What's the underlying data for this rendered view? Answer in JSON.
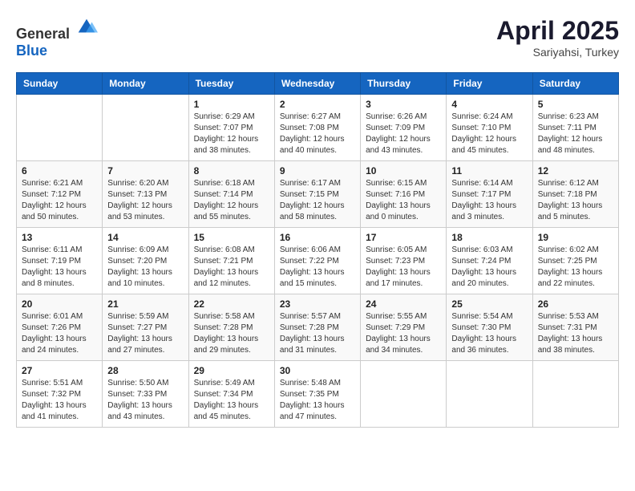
{
  "header": {
    "logo_general": "General",
    "logo_blue": "Blue",
    "month": "April 2025",
    "location": "Sariyahsi, Turkey"
  },
  "days_of_week": [
    "Sunday",
    "Monday",
    "Tuesday",
    "Wednesday",
    "Thursday",
    "Friday",
    "Saturday"
  ],
  "weeks": [
    [
      {
        "day": "",
        "sunrise": "",
        "sunset": "",
        "daylight": ""
      },
      {
        "day": "",
        "sunrise": "",
        "sunset": "",
        "daylight": ""
      },
      {
        "day": "1",
        "sunrise": "Sunrise: 6:29 AM",
        "sunset": "Sunset: 7:07 PM",
        "daylight": "Daylight: 12 hours and 38 minutes."
      },
      {
        "day": "2",
        "sunrise": "Sunrise: 6:27 AM",
        "sunset": "Sunset: 7:08 PM",
        "daylight": "Daylight: 12 hours and 40 minutes."
      },
      {
        "day": "3",
        "sunrise": "Sunrise: 6:26 AM",
        "sunset": "Sunset: 7:09 PM",
        "daylight": "Daylight: 12 hours and 43 minutes."
      },
      {
        "day": "4",
        "sunrise": "Sunrise: 6:24 AM",
        "sunset": "Sunset: 7:10 PM",
        "daylight": "Daylight: 12 hours and 45 minutes."
      },
      {
        "day": "5",
        "sunrise": "Sunrise: 6:23 AM",
        "sunset": "Sunset: 7:11 PM",
        "daylight": "Daylight: 12 hours and 48 minutes."
      }
    ],
    [
      {
        "day": "6",
        "sunrise": "Sunrise: 6:21 AM",
        "sunset": "Sunset: 7:12 PM",
        "daylight": "Daylight: 12 hours and 50 minutes."
      },
      {
        "day": "7",
        "sunrise": "Sunrise: 6:20 AM",
        "sunset": "Sunset: 7:13 PM",
        "daylight": "Daylight: 12 hours and 53 minutes."
      },
      {
        "day": "8",
        "sunrise": "Sunrise: 6:18 AM",
        "sunset": "Sunset: 7:14 PM",
        "daylight": "Daylight: 12 hours and 55 minutes."
      },
      {
        "day": "9",
        "sunrise": "Sunrise: 6:17 AM",
        "sunset": "Sunset: 7:15 PM",
        "daylight": "Daylight: 12 hours and 58 minutes."
      },
      {
        "day": "10",
        "sunrise": "Sunrise: 6:15 AM",
        "sunset": "Sunset: 7:16 PM",
        "daylight": "Daylight: 13 hours and 0 minutes."
      },
      {
        "day": "11",
        "sunrise": "Sunrise: 6:14 AM",
        "sunset": "Sunset: 7:17 PM",
        "daylight": "Daylight: 13 hours and 3 minutes."
      },
      {
        "day": "12",
        "sunrise": "Sunrise: 6:12 AM",
        "sunset": "Sunset: 7:18 PM",
        "daylight": "Daylight: 13 hours and 5 minutes."
      }
    ],
    [
      {
        "day": "13",
        "sunrise": "Sunrise: 6:11 AM",
        "sunset": "Sunset: 7:19 PM",
        "daylight": "Daylight: 13 hours and 8 minutes."
      },
      {
        "day": "14",
        "sunrise": "Sunrise: 6:09 AM",
        "sunset": "Sunset: 7:20 PM",
        "daylight": "Daylight: 13 hours and 10 minutes."
      },
      {
        "day": "15",
        "sunrise": "Sunrise: 6:08 AM",
        "sunset": "Sunset: 7:21 PM",
        "daylight": "Daylight: 13 hours and 12 minutes."
      },
      {
        "day": "16",
        "sunrise": "Sunrise: 6:06 AM",
        "sunset": "Sunset: 7:22 PM",
        "daylight": "Daylight: 13 hours and 15 minutes."
      },
      {
        "day": "17",
        "sunrise": "Sunrise: 6:05 AM",
        "sunset": "Sunset: 7:23 PM",
        "daylight": "Daylight: 13 hours and 17 minutes."
      },
      {
        "day": "18",
        "sunrise": "Sunrise: 6:03 AM",
        "sunset": "Sunset: 7:24 PM",
        "daylight": "Daylight: 13 hours and 20 minutes."
      },
      {
        "day": "19",
        "sunrise": "Sunrise: 6:02 AM",
        "sunset": "Sunset: 7:25 PM",
        "daylight": "Daylight: 13 hours and 22 minutes."
      }
    ],
    [
      {
        "day": "20",
        "sunrise": "Sunrise: 6:01 AM",
        "sunset": "Sunset: 7:26 PM",
        "daylight": "Daylight: 13 hours and 24 minutes."
      },
      {
        "day": "21",
        "sunrise": "Sunrise: 5:59 AM",
        "sunset": "Sunset: 7:27 PM",
        "daylight": "Daylight: 13 hours and 27 minutes."
      },
      {
        "day": "22",
        "sunrise": "Sunrise: 5:58 AM",
        "sunset": "Sunset: 7:28 PM",
        "daylight": "Daylight: 13 hours and 29 minutes."
      },
      {
        "day": "23",
        "sunrise": "Sunrise: 5:57 AM",
        "sunset": "Sunset: 7:28 PM",
        "daylight": "Daylight: 13 hours and 31 minutes."
      },
      {
        "day": "24",
        "sunrise": "Sunrise: 5:55 AM",
        "sunset": "Sunset: 7:29 PM",
        "daylight": "Daylight: 13 hours and 34 minutes."
      },
      {
        "day": "25",
        "sunrise": "Sunrise: 5:54 AM",
        "sunset": "Sunset: 7:30 PM",
        "daylight": "Daylight: 13 hours and 36 minutes."
      },
      {
        "day": "26",
        "sunrise": "Sunrise: 5:53 AM",
        "sunset": "Sunset: 7:31 PM",
        "daylight": "Daylight: 13 hours and 38 minutes."
      }
    ],
    [
      {
        "day": "27",
        "sunrise": "Sunrise: 5:51 AM",
        "sunset": "Sunset: 7:32 PM",
        "daylight": "Daylight: 13 hours and 41 minutes."
      },
      {
        "day": "28",
        "sunrise": "Sunrise: 5:50 AM",
        "sunset": "Sunset: 7:33 PM",
        "daylight": "Daylight: 13 hours and 43 minutes."
      },
      {
        "day": "29",
        "sunrise": "Sunrise: 5:49 AM",
        "sunset": "Sunset: 7:34 PM",
        "daylight": "Daylight: 13 hours and 45 minutes."
      },
      {
        "day": "30",
        "sunrise": "Sunrise: 5:48 AM",
        "sunset": "Sunset: 7:35 PM",
        "daylight": "Daylight: 13 hours and 47 minutes."
      },
      {
        "day": "",
        "sunrise": "",
        "sunset": "",
        "daylight": ""
      },
      {
        "day": "",
        "sunrise": "",
        "sunset": "",
        "daylight": ""
      },
      {
        "day": "",
        "sunrise": "",
        "sunset": "",
        "daylight": ""
      }
    ]
  ]
}
